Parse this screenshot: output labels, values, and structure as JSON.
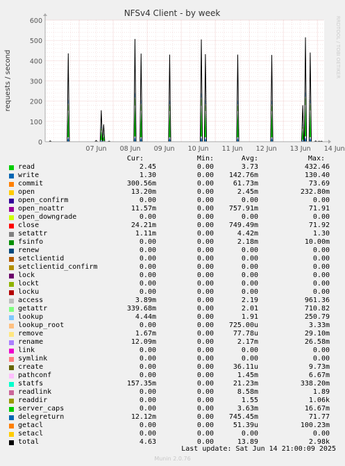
{
  "chart_data": {
    "type": "line",
    "title": "NFSv4 Client - by week",
    "ylabel": "requests / second",
    "right_label": "RRDTOOL / TOBI OETIKER",
    "xlabels": [
      "07 Jun",
      "08 Jun",
      "09 Jun",
      "10 Jun",
      "11 Jun",
      "12 Jun",
      "13 Jun",
      "14 Jun"
    ],
    "yticks": [
      0,
      100,
      200,
      300,
      400,
      500,
      600
    ],
    "ylim": [
      0,
      600
    ],
    "x_range_days": [
      6.0,
      14.2
    ],
    "grid": true,
    "spikes": [
      {
        "day": 6.68,
        "value": 436
      },
      {
        "day": 7.65,
        "value": 155
      },
      {
        "day": 7.72,
        "value": 85
      },
      {
        "day": 8.64,
        "value": 507
      },
      {
        "day": 8.82,
        "value": 435
      },
      {
        "day": 9.66,
        "value": 430
      },
      {
        "day": 10.59,
        "value": 505
      },
      {
        "day": 10.71,
        "value": 432
      },
      {
        "day": 11.66,
        "value": 430
      },
      {
        "day": 12.66,
        "value": 428
      },
      {
        "day": 13.57,
        "value": 180
      },
      {
        "day": 13.65,
        "value": 515
      },
      {
        "day": 13.79,
        "value": 440
      }
    ],
    "small_bumps": [
      {
        "day": 6.15,
        "value": 4
      },
      {
        "day": 7.5,
        "value": 6
      },
      {
        "day": 7.88,
        "value": 3
      },
      {
        "day": 13.95,
        "value": 4
      },
      {
        "day": 14.05,
        "value": 3
      },
      {
        "day": 14.12,
        "value": 3
      }
    ],
    "series_colors": {
      "total": "#000000",
      "read": "#00cc00",
      "write": "#0066b3",
      "commit": "#ff8000",
      "lookup": "#8fcbf7",
      "getattr": "#8fe67a"
    }
  },
  "legend": {
    "headers": {
      "cur": "Cur:",
      "min": "Min:",
      "avg": "Avg:",
      "max": "Max:"
    },
    "rows": [
      {
        "name": "read",
        "color": "#00cc00",
        "cur": "2.45",
        "min": "0.00",
        "avg": "3.73",
        "max": "432.46"
      },
      {
        "name": "write",
        "color": "#0066b3",
        "cur": "1.30",
        "min": "0.00",
        "avg": "142.76m",
        "max": "130.40"
      },
      {
        "name": "commit",
        "color": "#ff8000",
        "cur": "300.56m",
        "min": "0.00",
        "avg": "61.73m",
        "max": "73.69"
      },
      {
        "name": "open",
        "color": "#ffcc00",
        "cur": "13.20m",
        "min": "0.00",
        "avg": "2.45m",
        "max": "232.80m"
      },
      {
        "name": "open_confirm",
        "color": "#330099",
        "cur": "0.00",
        "min": "0.00",
        "avg": "0.00",
        "max": "0.00"
      },
      {
        "name": "open_noattr",
        "color": "#990099",
        "cur": "11.57m",
        "min": "0.00",
        "avg": "757.91m",
        "max": "71.91"
      },
      {
        "name": "open_downgrade",
        "color": "#ccff00",
        "cur": "0.00",
        "min": "0.00",
        "avg": "0.00",
        "max": "0.00"
      },
      {
        "name": "close",
        "color": "#ff0000",
        "cur": "24.21m",
        "min": "0.00",
        "avg": "749.49m",
        "max": "71.92"
      },
      {
        "name": "setattr",
        "color": "#808080",
        "cur": "1.11m",
        "min": "0.00",
        "avg": "4.42m",
        "max": "1.30"
      },
      {
        "name": "fsinfo",
        "color": "#008f00",
        "cur": "0.00",
        "min": "0.00",
        "avg": "2.18m",
        "max": "10.00m"
      },
      {
        "name": "renew",
        "color": "#00487d",
        "cur": "0.00",
        "min": "0.00",
        "avg": "0.00",
        "max": "0.00"
      },
      {
        "name": "setclientid",
        "color": "#b35a00",
        "cur": "0.00",
        "min": "0.00",
        "avg": "0.00",
        "max": "0.00"
      },
      {
        "name": "setclientid_confirm",
        "color": "#b38f00",
        "cur": "0.00",
        "min": "0.00",
        "avg": "0.00",
        "max": "0.00"
      },
      {
        "name": "lock",
        "color": "#6b006b",
        "cur": "0.00",
        "min": "0.00",
        "avg": "0.00",
        "max": "0.00"
      },
      {
        "name": "lockt",
        "color": "#8fb300",
        "cur": "0.00",
        "min": "0.00",
        "avg": "0.00",
        "max": "0.00"
      },
      {
        "name": "locku",
        "color": "#b30000",
        "cur": "0.00",
        "min": "0.00",
        "avg": "0.00",
        "max": "0.00"
      },
      {
        "name": "access",
        "color": "#bebebe",
        "cur": "3.89m",
        "min": "0.00",
        "avg": "2.19",
        "max": "961.36"
      },
      {
        "name": "getattr",
        "color": "#80ff80",
        "cur": "339.68m",
        "min": "0.00",
        "avg": "2.01",
        "max": "710.82"
      },
      {
        "name": "lookup",
        "color": "#80c9ff",
        "cur": "4.44m",
        "min": "0.00",
        "avg": "1.91",
        "max": "250.79"
      },
      {
        "name": "lookup_root",
        "color": "#ffc080",
        "cur": "0.00",
        "min": "0.00",
        "avg": "725.00u",
        "max": "3.33m"
      },
      {
        "name": "remove",
        "color": "#ffe680",
        "cur": "1.67m",
        "min": "0.00",
        "avg": "77.78u",
        "max": "29.10m"
      },
      {
        "name": "rename",
        "color": "#aa80ff",
        "cur": "12.09m",
        "min": "0.00",
        "avg": "2.17m",
        "max": "26.58m"
      },
      {
        "name": "link",
        "color": "#ee00cc",
        "cur": "0.00",
        "min": "0.00",
        "avg": "0.00",
        "max": "0.00"
      },
      {
        "name": "symlink",
        "color": "#ff8080",
        "cur": "0.00",
        "min": "0.00",
        "avg": "0.00",
        "max": "0.00"
      },
      {
        "name": "create",
        "color": "#666600",
        "cur": "0.00",
        "min": "0.00",
        "avg": "36.11u",
        "max": "9.73m"
      },
      {
        "name": "pathconf",
        "color": "#ffbfff",
        "cur": "0.00",
        "min": "0.00",
        "avg": "1.45m",
        "max": "6.67m"
      },
      {
        "name": "statfs",
        "color": "#00ffcc",
        "cur": "157.35m",
        "min": "0.00",
        "avg": "21.23m",
        "max": "338.20m"
      },
      {
        "name": "readlink",
        "color": "#cc6699",
        "cur": "0.00",
        "min": "0.00",
        "avg": "8.58m",
        "max": "1.89"
      },
      {
        "name": "readdir",
        "color": "#999900",
        "cur": "0.00",
        "min": "0.00",
        "avg": "1.55",
        "max": "1.06k"
      },
      {
        "name": "server_caps",
        "color": "#00cc00",
        "cur": "0.00",
        "min": "0.00",
        "avg": "3.63m",
        "max": "16.67m"
      },
      {
        "name": "delegreturn",
        "color": "#0066b3",
        "cur": "12.12m",
        "min": "0.00",
        "avg": "745.45m",
        "max": "71.77"
      },
      {
        "name": "getacl",
        "color": "#ff8000",
        "cur": "0.00",
        "min": "0.00",
        "avg": "51.39u",
        "max": "100.23m"
      },
      {
        "name": "setacl",
        "color": "#ffcc00",
        "cur": "0.00",
        "min": "0.00",
        "avg": "0.00",
        "max": "0.00"
      },
      {
        "name": "total",
        "color": "#000000",
        "cur": "4.63",
        "min": "0.00",
        "avg": "13.89",
        "max": "2.98k"
      }
    ]
  },
  "footer": {
    "last_update": "Last update: Sat Jun 14 21:00:09 2025",
    "munin_version": "Munin 2.0.76"
  }
}
